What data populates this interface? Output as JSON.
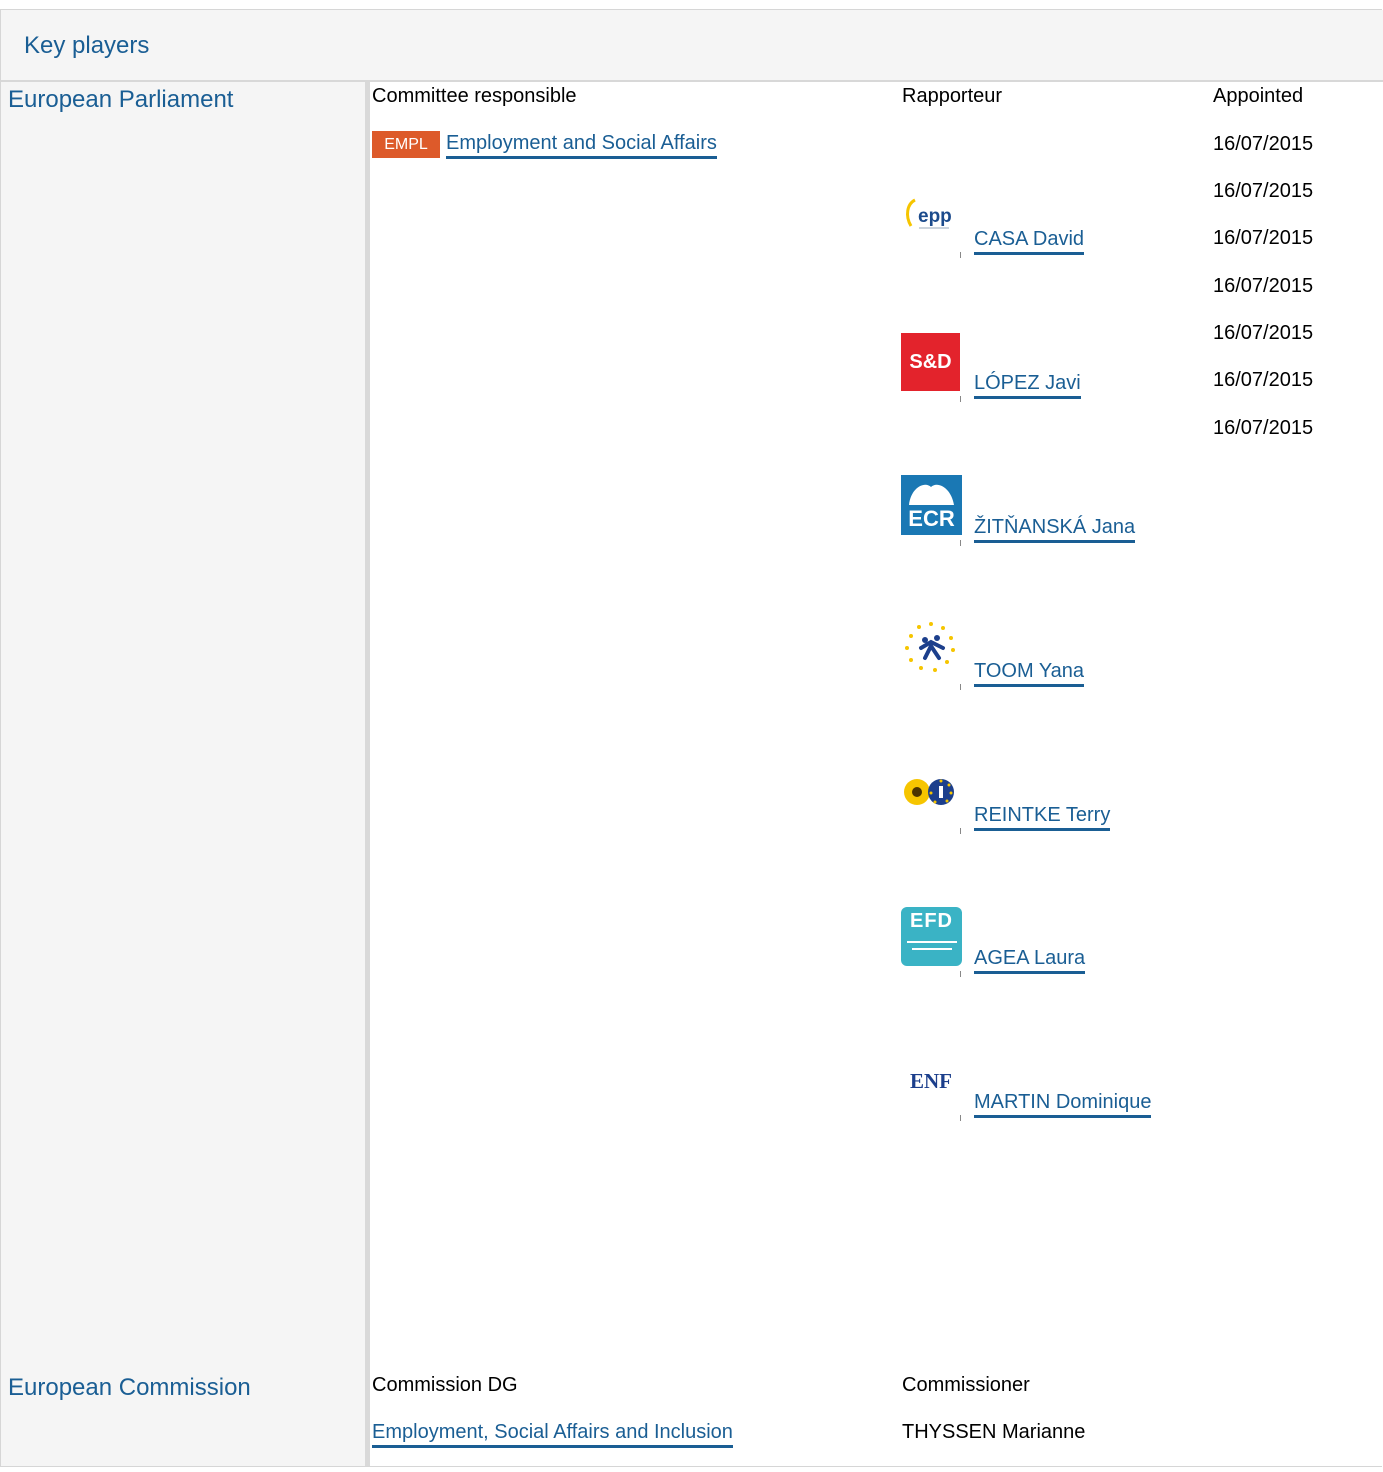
{
  "header": {
    "title": "Key players"
  },
  "parliament": {
    "label": "European Parliament",
    "col_committee": "Committee responsible",
    "col_rapporteur": "Rapporteur",
    "col_appointed": "Appointed",
    "committee_badge": "EMPL",
    "committee_name": "Employment and Social Affairs",
    "dates": [
      "16/07/2015",
      "16/07/2015",
      "16/07/2015",
      "16/07/2015",
      "16/07/2015",
      "16/07/2015",
      "16/07/2015"
    ],
    "rapporteurs": [
      {
        "name": "CASA David",
        "group_logo": "epp-logo",
        "logo_text": "epp"
      },
      {
        "name": "LÓPEZ Javi",
        "group_logo": "s-and-d-logo",
        "logo_text": "S&D"
      },
      {
        "name": "ŽITŇANSKÁ Jana",
        "group_logo": "ecr-logo",
        "logo_text": "ECR"
      },
      {
        "name": "TOOM Yana",
        "group_logo": "alde-logo"
      },
      {
        "name": "REINTKE Terry",
        "group_logo": "greens-efa-logo"
      },
      {
        "name": "AGEA Laura",
        "group_logo": "efdd-logo",
        "logo_text": "EFD"
      },
      {
        "name": "MARTIN Dominique",
        "group_logo": "enf-logo",
        "logo_text": "ENF"
      }
    ]
  },
  "commission": {
    "label": "European Commission",
    "col_dg": "Commission DG",
    "col_commissioner": "Commissioner",
    "dg_name": "Employment, Social Affairs and Inclusion",
    "commissioner": "THYSSEN Marianne"
  },
  "colors": {
    "link": "#1a5e94",
    "badge": "#dd5a2a",
    "sd_red": "#e3232c",
    "ecr_blue": "#1a78b4",
    "efd_teal": "#3ab3c5"
  }
}
